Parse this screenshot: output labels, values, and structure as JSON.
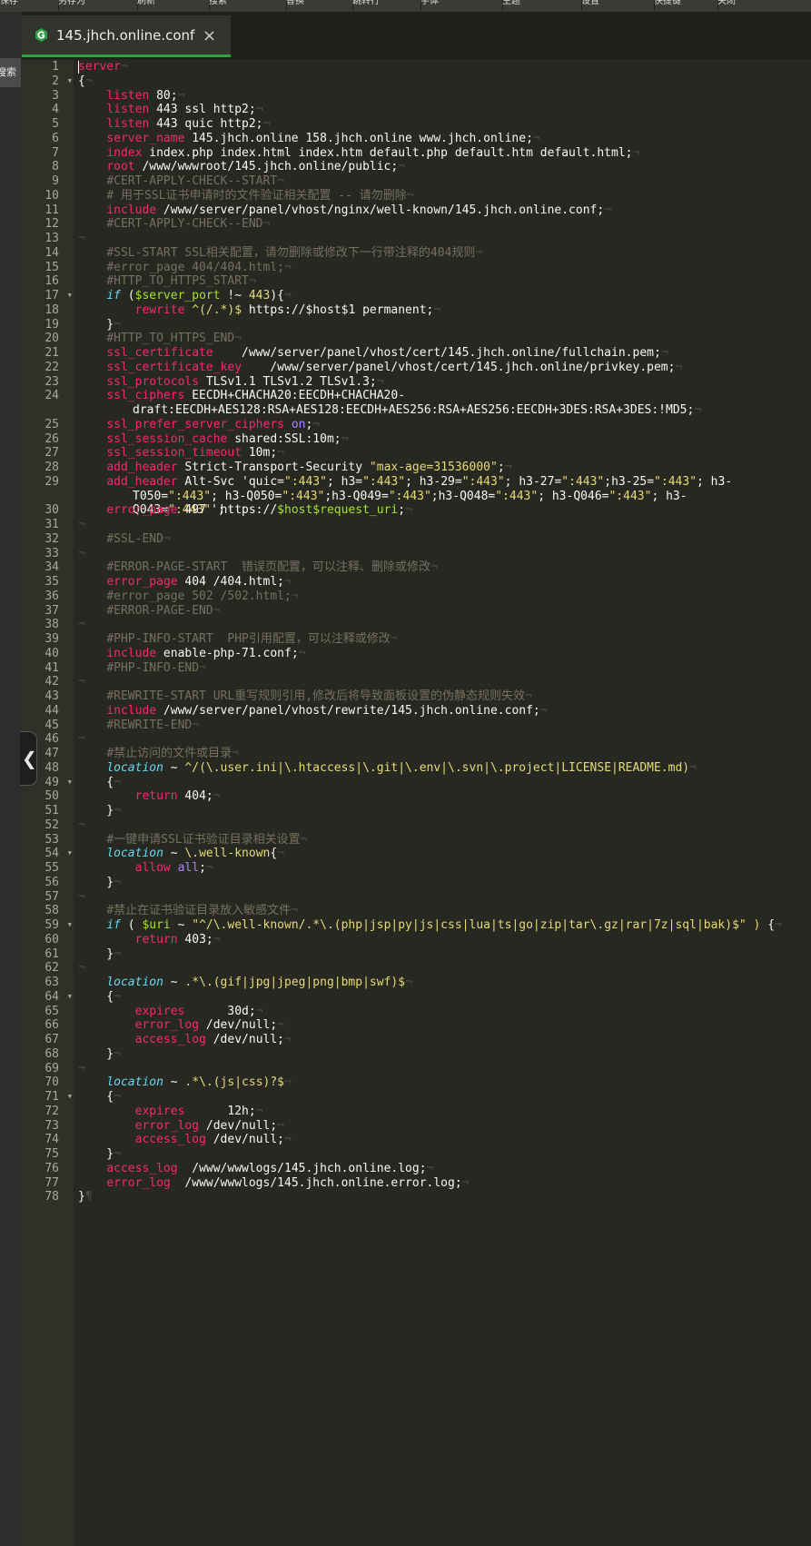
{
  "toolbar": {
    "items": [
      "保存",
      "另存为",
      "刷新",
      "搜索",
      "替换",
      "跳转行",
      "字体",
      "主题",
      "设置",
      "快捷键",
      "关闭"
    ]
  },
  "sidebar": {
    "search_label": "搜索"
  },
  "tab": {
    "title": "145.jhch.online.conf",
    "close": "×"
  },
  "colors": {
    "background": "#272822",
    "keyword": "#f92672",
    "string": "#e6db74",
    "comment": "#75715e",
    "active_tab_underline": "#2ea043"
  },
  "editor": {
    "line_count": 78,
    "cursor": {
      "line": 1,
      "column": 1
    },
    "lines": [
      "server¬",
      "{¬",
      "    listen 80;¬",
      "    listen 443 ssl http2;¬",
      "    listen 443 quic http2;¬",
      "    server_name 145.jhch.online 158.jhch.online www.jhch.online;¬",
      "    index index.php index.html index.htm default.php default.htm default.html;¬",
      "    root /www/wwwroot/145.jhch.online/public;¬",
      "    #CERT-APPLY-CHECK--START¬",
      "    # 用于SSL证书申请时的文件验证相关配置 -- 请勿删除¬",
      "    include /www/server/panel/vhost/nginx/well-known/145.jhch.online.conf;¬",
      "    #CERT-APPLY-CHECK--END¬",
      "¬",
      "    #SSL-START SSL相关配置，请勿删除或修改下一行带注释的404规则¬",
      "    #error_page 404/404.html;¬",
      "    #HTTP_TO_HTTPS_START¬",
      "    if ($server_port !~ 443){¬",
      "        rewrite ^(/.*)$ https://$host$1 permanent;¬",
      "    }¬",
      "    #HTTP_TO_HTTPS_END¬",
      "    ssl_certificate    /www/server/panel/vhost/cert/145.jhch.online/fullchain.pem;¬",
      "    ssl_certificate_key    /www/server/panel/vhost/cert/145.jhch.online/privkey.pem;¬",
      "    ssl_protocols TLSv1.1 TLSv1.2 TLSv1.3;¬",
      "    ssl_ciphers EECDH+CHACHA20:EECDH+CHACHA20-draft:EECDH+AES128:RSA+AES128:EECDH+AES256:RSA+AES256:EECDH+3DES:RSA+3DES:!MD5;¬",
      "    ssl_prefer_server_ciphers on;¬",
      "    ssl_session_cache shared:SSL:10m;¬",
      "    ssl_session_timeout 10m;¬",
      "    add_header Strict-Transport-Security \"max-age=31536000\";¬",
      "    add_header Alt-Svc 'quic=\":443\"; h3=\":443\"; h3-29=\":443\"; h3-27=\":443\";h3-25=\":443\"; h3-T050=\":443\"; h3-Q050=\":443\";h3-Q049=\":443\";h3-Q048=\":443\"; h3-Q046=\":443\"; h3-Q043=\":443\"';¬",
      "    error_page 497  https://$host$request_uri;¬",
      "¬",
      "    #SSL-END¬",
      "¬",
      "    #ERROR-PAGE-START  错误页配置，可以注释、删除或修改¬",
      "    error_page 404 /404.html;¬",
      "    #error_page 502 /502.html;¬",
      "    #ERROR-PAGE-END¬",
      "¬",
      "    #PHP-INFO-START  PHP引用配置，可以注释或修改¬",
      "    include enable-php-71.conf;¬",
      "    #PHP-INFO-END¬",
      "¬",
      "    #REWRITE-START URL重写规则引用,修改后将导致面板设置的伪静态规则失效¬",
      "    include /www/server/panel/vhost/rewrite/145.jhch.online.conf;¬",
      "    #REWRITE-END¬",
      "¬",
      "    #禁止访问的文件或目录¬",
      "    location ~ ^/(\\.user.ini|\\.htaccess|\\.git|\\.env|\\.svn|\\.project|LICENSE|README.md)¬",
      "    {¬",
      "        return 404;¬",
      "    }¬",
      "¬",
      "    #一键申请SSL证书验证目录相关设置¬",
      "    location ~ \\.well-known{¬",
      "        allow all;¬",
      "    }¬",
      "¬",
      "    #禁止在证书验证目录放入敏感文件¬",
      "    if ( $uri ~ \"^/\\.well-known/.*\\.(php|jsp|py|js|css|lua|ts|go|zip|tar\\.gz|rar|7z|sql|bak)$\" ) {¬",
      "        return 403;¬",
      "    }¬",
      "¬",
      "    location ~ .*\\.(gif|jpg|jpeg|png|bmp|swf)$¬",
      "    {¬",
      "        expires      30d;¬",
      "        error_log /dev/null;¬",
      "        access_log /dev/null;¬",
      "    }¬",
      "¬",
      "    location ~ .*\\.(js|css)?$¬",
      "    {¬",
      "        expires      12h;¬",
      "        error_log /dev/null;¬",
      "        access_log /dev/null;¬",
      "    }¬",
      "    access_log  /www/wwwlogs/145.jhch.online.log;¬",
      "    error_log  /www/wwwlogs/145.jhch.online.error.log;¬",
      "}¶"
    ]
  }
}
